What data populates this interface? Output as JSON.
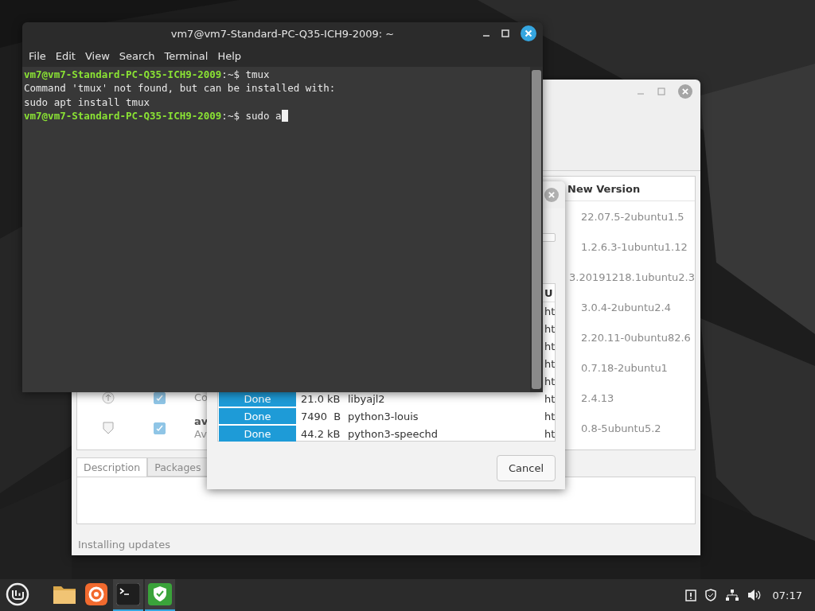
{
  "terminal": {
    "title": "vm7@vm7-Standard-PC-Q35-ICH9-2009: ~",
    "menu": [
      "File",
      "Edit",
      "View",
      "Search",
      "Terminal",
      "Help"
    ],
    "lines": [
      {
        "kind": "prompt",
        "user": "vm7@vm7-Standard-PC-Q35-ICH9-2009",
        "path": ":~$",
        "command": "tmux"
      },
      {
        "kind": "output",
        "text": "Command 'tmux' not found, but can be installed with:"
      },
      {
        "kind": "output",
        "text": "sudo apt install tmux"
      },
      {
        "kind": "prompt",
        "user": "vm7@vm7-Standard-PC-Q35-ICH9-2009",
        "path": ":~$",
        "command": "sudo a"
      }
    ]
  },
  "update_manager": {
    "column_header": "New Version",
    "rows": [
      {
        "new_version": "22.07.5-2ubuntu1.5"
      },
      {
        "new_version": "1.2.6.3-1ubuntu1.12"
      },
      {
        "new_version": "3.20191218.1ubuntu2.3"
      },
      {
        "new_version": "3.0.4-2ubuntu2.4"
      },
      {
        "new_version": "2.20.11-0ubuntu82.6"
      },
      {
        "new_version": "0.7.18-2ubuntu1"
      },
      {
        "kind": "package",
        "checked": true,
        "description": "Co",
        "new_version": "2.4.13"
      },
      {
        "kind": "security",
        "checked": true,
        "name": "av",
        "description": "Av",
        "new_version": "0.8-5ubuntu5.2"
      }
    ],
    "tabs": [
      {
        "label": "Description",
        "selected": true
      },
      {
        "label": "Packages",
        "selected": false
      }
    ],
    "status": "Installing updates"
  },
  "dialog": {
    "column_header": "U",
    "rows": [
      {
        "url": "ht"
      },
      {
        "url": "ht"
      },
      {
        "url": "ht"
      },
      {
        "url": "ht"
      },
      {
        "url": "ht"
      },
      {
        "status": "Done",
        "size": "21.0 kB",
        "name": "libyajl2",
        "url": "ht"
      },
      {
        "status": "Done",
        "size": "7490  B",
        "name": "python3-louis",
        "url": "ht"
      },
      {
        "status": "Done",
        "size": "44.2 kB",
        "name": "python3-speechd",
        "url": "ht"
      }
    ],
    "cancel": "Cancel"
  },
  "taskbar": {
    "apps": [
      {
        "kind": "menu",
        "active": false
      },
      {
        "kind": "folder",
        "active": false
      },
      {
        "kind": "browser",
        "active": false
      },
      {
        "kind": "terminal",
        "active": true
      },
      {
        "kind": "shield",
        "active": true
      }
    ],
    "clock": "07:17"
  }
}
